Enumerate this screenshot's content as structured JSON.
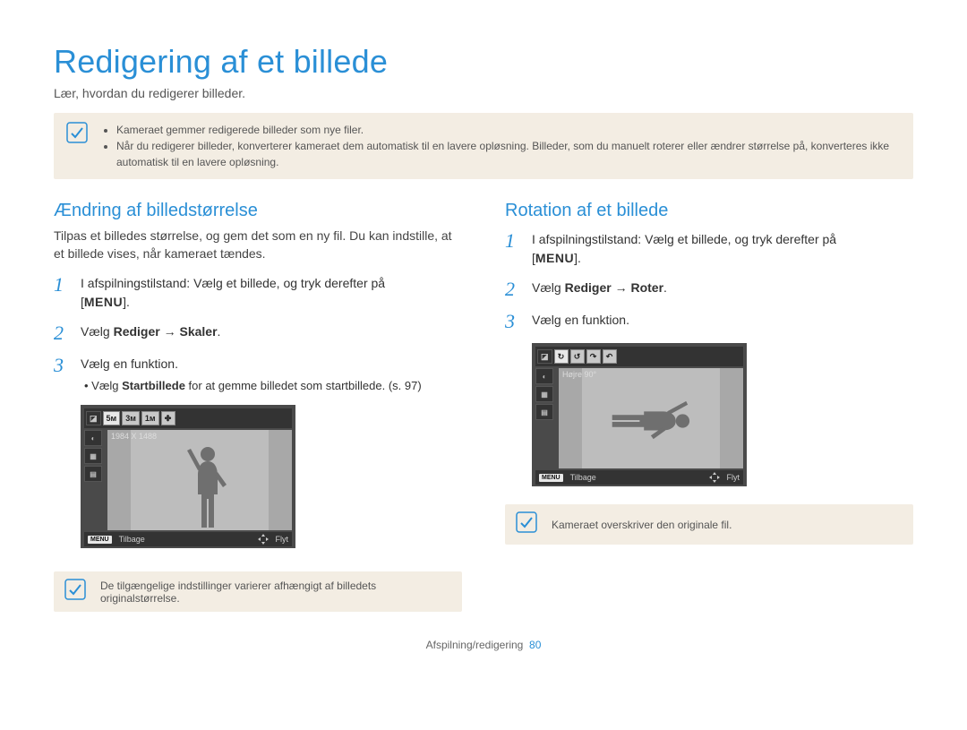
{
  "title": "Redigering af et billede",
  "intro": "Lær, hvordan du redigerer billeder.",
  "top_note": {
    "bullets": [
      "Kameraet gemmer redigerede billeder som nye filer.",
      "Når du redigerer billeder, konverterer kameraet dem automatisk til en lavere opløsning. Billeder, som du manuelt roterer eller ændrer størrelse på, konverteres ikke automatisk til en lavere opløsning."
    ]
  },
  "left": {
    "heading": "Ændring af billedstørrelse",
    "intro": "Tilpas et billedes størrelse, og gem det som en ny fil. Du kan indstille, at et billede vises, når kameraet tændes.",
    "steps": {
      "s1_a": "I afspilningstilstand: Vælg et billede, og tryk derefter på",
      "menu": "MENU",
      "s2_a": "Vælg ",
      "s2_b": "Rediger",
      "s2_arrow": " → ",
      "s2_c": "Skaler",
      "s3": "Vælg en funktion.",
      "s3_sub_a": "Vælg ",
      "s3_sub_b": "Startbillede",
      "s3_sub_c": " for at gemme billedet som startbillede. (s. 97)"
    },
    "lcd": {
      "top_labels": [
        "◪",
        "5ᴍ",
        "3ᴍ",
        "1ᴍ",
        "✤"
      ],
      "res_text": "1984 X 1488",
      "footer_menu": "MENU",
      "footer_back": "Tilbage",
      "footer_move": "Flyt"
    },
    "bottom_note": "De tilgængelige indstillinger varierer afhængigt af billedets originalstørrelse."
  },
  "right": {
    "heading": "Rotation af et billede",
    "steps": {
      "s1_a": "I afspilningstilstand: Vælg et billede, og tryk derefter på",
      "menu": "MENU",
      "s2_a": "Vælg ",
      "s2_b": "Rediger",
      "s2_arrow": " → ",
      "s2_c": "Roter",
      "s3": "Vælg en funktion."
    },
    "lcd": {
      "top_labels": [
        "◪",
        "↻",
        "↺",
        "↷",
        "↶"
      ],
      "info_text": "Højre 90°",
      "footer_menu": "MENU",
      "footer_back": "Tilbage",
      "footer_move": "Flyt"
    },
    "bottom_note": "Kameraet overskriver den originale fil."
  },
  "footer": {
    "section": "Afspilning/redigering",
    "page": "80"
  }
}
